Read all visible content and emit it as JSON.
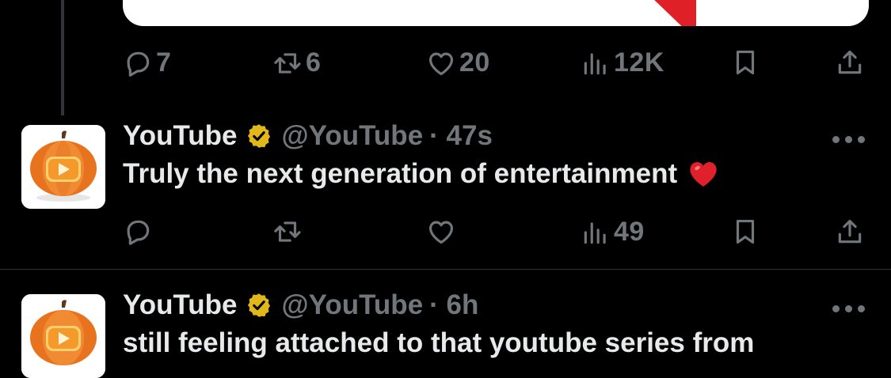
{
  "tweet1_actions": {
    "replies": "7",
    "reposts": "6",
    "likes": "20",
    "views": "12K"
  },
  "tweet2": {
    "name": "YouTube",
    "handle": "@YouTube",
    "time": "· 47s",
    "text": "Truly the next generation of entertainment",
    "emoji": "red-heart",
    "views": "49"
  },
  "tweet3": {
    "name": "YouTube",
    "handle": "@YouTube",
    "time": "· 6h",
    "text_partial": "still feeling attached to that youtube series from"
  },
  "colors": {
    "background": "#000000",
    "text": "#e7e9ea",
    "muted": "#71767b",
    "verified_gold": "#e2b719",
    "heart_red": "#e0202b",
    "pumpkin_orange": "#e8731f"
  },
  "icons": [
    "reply-icon",
    "repost-icon",
    "like-icon",
    "views-icon",
    "bookmark-icon",
    "share-icon",
    "verified-badge-icon",
    "more-icon",
    "pumpkin-youtube-avatar"
  ]
}
